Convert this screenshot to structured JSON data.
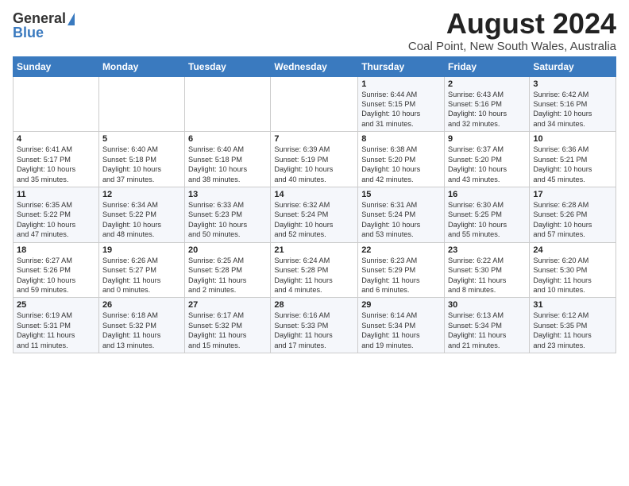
{
  "header": {
    "logo_line1": "General",
    "logo_line2": "Blue",
    "title": "August 2024",
    "subtitle": "Coal Point, New South Wales, Australia"
  },
  "calendar": {
    "weekdays": [
      "Sunday",
      "Monday",
      "Tuesday",
      "Wednesday",
      "Thursday",
      "Friday",
      "Saturday"
    ],
    "weeks": [
      [
        {
          "day": "",
          "content": ""
        },
        {
          "day": "",
          "content": ""
        },
        {
          "day": "",
          "content": ""
        },
        {
          "day": "",
          "content": ""
        },
        {
          "day": "1",
          "content": "Sunrise: 6:44 AM\nSunset: 5:15 PM\nDaylight: 10 hours\nand 31 minutes."
        },
        {
          "day": "2",
          "content": "Sunrise: 6:43 AM\nSunset: 5:16 PM\nDaylight: 10 hours\nand 32 minutes."
        },
        {
          "day": "3",
          "content": "Sunrise: 6:42 AM\nSunset: 5:16 PM\nDaylight: 10 hours\nand 34 minutes."
        }
      ],
      [
        {
          "day": "4",
          "content": "Sunrise: 6:41 AM\nSunset: 5:17 PM\nDaylight: 10 hours\nand 35 minutes."
        },
        {
          "day": "5",
          "content": "Sunrise: 6:40 AM\nSunset: 5:18 PM\nDaylight: 10 hours\nand 37 minutes."
        },
        {
          "day": "6",
          "content": "Sunrise: 6:40 AM\nSunset: 5:18 PM\nDaylight: 10 hours\nand 38 minutes."
        },
        {
          "day": "7",
          "content": "Sunrise: 6:39 AM\nSunset: 5:19 PM\nDaylight: 10 hours\nand 40 minutes."
        },
        {
          "day": "8",
          "content": "Sunrise: 6:38 AM\nSunset: 5:20 PM\nDaylight: 10 hours\nand 42 minutes."
        },
        {
          "day": "9",
          "content": "Sunrise: 6:37 AM\nSunset: 5:20 PM\nDaylight: 10 hours\nand 43 minutes."
        },
        {
          "day": "10",
          "content": "Sunrise: 6:36 AM\nSunset: 5:21 PM\nDaylight: 10 hours\nand 45 minutes."
        }
      ],
      [
        {
          "day": "11",
          "content": "Sunrise: 6:35 AM\nSunset: 5:22 PM\nDaylight: 10 hours\nand 47 minutes."
        },
        {
          "day": "12",
          "content": "Sunrise: 6:34 AM\nSunset: 5:22 PM\nDaylight: 10 hours\nand 48 minutes."
        },
        {
          "day": "13",
          "content": "Sunrise: 6:33 AM\nSunset: 5:23 PM\nDaylight: 10 hours\nand 50 minutes."
        },
        {
          "day": "14",
          "content": "Sunrise: 6:32 AM\nSunset: 5:24 PM\nDaylight: 10 hours\nand 52 minutes."
        },
        {
          "day": "15",
          "content": "Sunrise: 6:31 AM\nSunset: 5:24 PM\nDaylight: 10 hours\nand 53 minutes."
        },
        {
          "day": "16",
          "content": "Sunrise: 6:30 AM\nSunset: 5:25 PM\nDaylight: 10 hours\nand 55 minutes."
        },
        {
          "day": "17",
          "content": "Sunrise: 6:28 AM\nSunset: 5:26 PM\nDaylight: 10 hours\nand 57 minutes."
        }
      ],
      [
        {
          "day": "18",
          "content": "Sunrise: 6:27 AM\nSunset: 5:26 PM\nDaylight: 10 hours\nand 59 minutes."
        },
        {
          "day": "19",
          "content": "Sunrise: 6:26 AM\nSunset: 5:27 PM\nDaylight: 11 hours\nand 0 minutes."
        },
        {
          "day": "20",
          "content": "Sunrise: 6:25 AM\nSunset: 5:28 PM\nDaylight: 11 hours\nand 2 minutes."
        },
        {
          "day": "21",
          "content": "Sunrise: 6:24 AM\nSunset: 5:28 PM\nDaylight: 11 hours\nand 4 minutes."
        },
        {
          "day": "22",
          "content": "Sunrise: 6:23 AM\nSunset: 5:29 PM\nDaylight: 11 hours\nand 6 minutes."
        },
        {
          "day": "23",
          "content": "Sunrise: 6:22 AM\nSunset: 5:30 PM\nDaylight: 11 hours\nand 8 minutes."
        },
        {
          "day": "24",
          "content": "Sunrise: 6:20 AM\nSunset: 5:30 PM\nDaylight: 11 hours\nand 10 minutes."
        }
      ],
      [
        {
          "day": "25",
          "content": "Sunrise: 6:19 AM\nSunset: 5:31 PM\nDaylight: 11 hours\nand 11 minutes."
        },
        {
          "day": "26",
          "content": "Sunrise: 6:18 AM\nSunset: 5:32 PM\nDaylight: 11 hours\nand 13 minutes."
        },
        {
          "day": "27",
          "content": "Sunrise: 6:17 AM\nSunset: 5:32 PM\nDaylight: 11 hours\nand 15 minutes."
        },
        {
          "day": "28",
          "content": "Sunrise: 6:16 AM\nSunset: 5:33 PM\nDaylight: 11 hours\nand 17 minutes."
        },
        {
          "day": "29",
          "content": "Sunrise: 6:14 AM\nSunset: 5:34 PM\nDaylight: 11 hours\nand 19 minutes."
        },
        {
          "day": "30",
          "content": "Sunrise: 6:13 AM\nSunset: 5:34 PM\nDaylight: 11 hours\nand 21 minutes."
        },
        {
          "day": "31",
          "content": "Sunrise: 6:12 AM\nSunset: 5:35 PM\nDaylight: 11 hours\nand 23 minutes."
        }
      ]
    ]
  }
}
